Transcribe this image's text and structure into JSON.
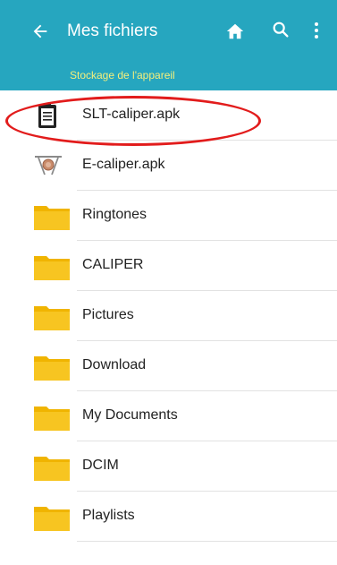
{
  "appbar": {
    "title": "Mes fichiers",
    "path": "Stockage de l'appareil",
    "back_icon": "arrow-left-icon",
    "home_icon": "home-icon",
    "search_icon": "search-icon",
    "more_icon": "more-vert-icon",
    "color": "#26a6bf",
    "path_color": "#f3ef7c"
  },
  "files": [
    {
      "name": "SLT-caliper.apk",
      "icon": "clipboard-icon"
    },
    {
      "name": "E-caliper.apk",
      "icon": "caliper-app-icon"
    },
    {
      "name": "Ringtones",
      "icon": "folder-icon"
    },
    {
      "name": "CALIPER",
      "icon": "folder-icon"
    },
    {
      "name": "Pictures",
      "icon": "folder-icon"
    },
    {
      "name": "Download",
      "icon": "folder-icon"
    },
    {
      "name": "My Documents",
      "icon": "folder-icon"
    },
    {
      "name": "DCIM",
      "icon": "folder-icon"
    },
    {
      "name": "Playlists",
      "icon": "folder-icon"
    }
  ],
  "annotation": {
    "highlight_color": "#e21c1c"
  }
}
